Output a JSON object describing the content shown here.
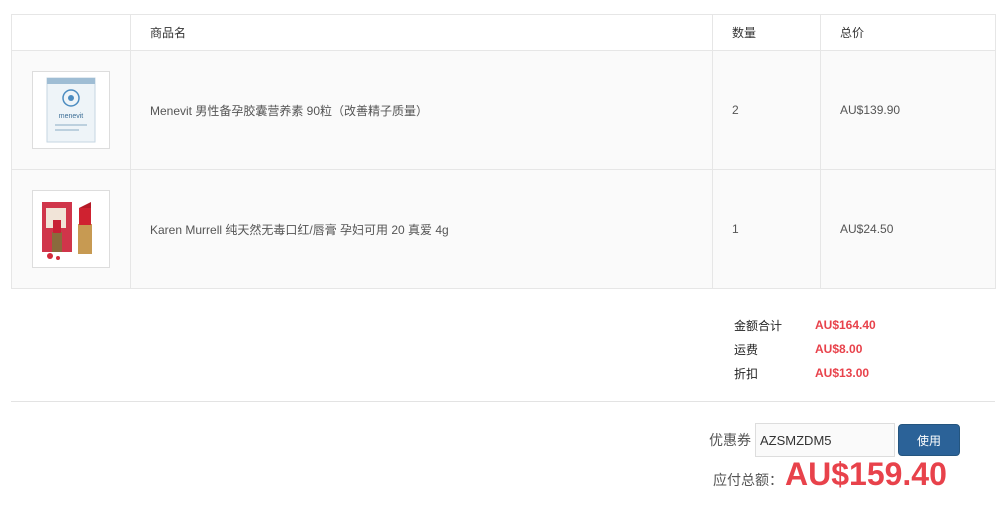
{
  "table": {
    "headers": [
      "",
      "商品名",
      "数量",
      "总价"
    ],
    "rows": [
      {
        "name": "Menevit 男性备孕胶囊营养素 90粒（改善精子质量）",
        "qty": "2",
        "price": "AU$139.90",
        "thumb_text": "menevit"
      },
      {
        "name": "Karen Murrell 纯天然无毒口红/唇膏 孕妇可用 20 真爱 4g",
        "qty": "1",
        "price": "AU$24.50"
      }
    ]
  },
  "summary": {
    "subtotal_label": "金额合计",
    "subtotal": "AU$164.40",
    "shipping_label": "运费",
    "shipping": "AU$8.00",
    "discount_label": "折扣",
    "discount": "AU$13.00"
  },
  "coupon": {
    "label": "优惠券",
    "value": "AZSMZDM5",
    "button": "使用"
  },
  "total": {
    "label": "应付总额：",
    "value": "AU$159.40"
  },
  "colors": {
    "accent": "#e8424b",
    "button": "#2b6298"
  }
}
